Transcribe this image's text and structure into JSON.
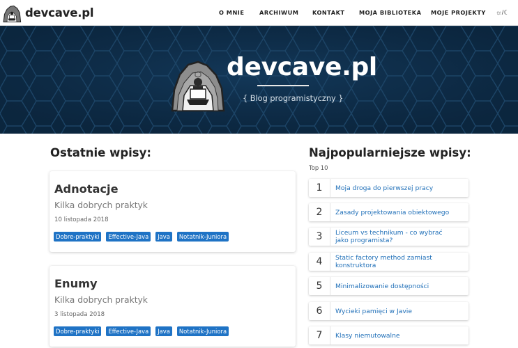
{
  "nav": {
    "brand": "devcave.pl",
    "items": [
      "O MNIE",
      "ARCHIWUM",
      "KONTAKT",
      "MOJA BIBLIOTEKA",
      "MOJE PROJEKTY"
    ],
    "theme_toggle": "☼/☾"
  },
  "hero": {
    "title": "devcave.pl",
    "subtitle": "{ Blog programistyczny }"
  },
  "latest": {
    "heading": "Ostatnie wpisy:",
    "posts": [
      {
        "title": "Adnotacje",
        "subtitle": "Kilka dobrych praktyk",
        "date": "10 listopada 2018",
        "tags": [
          "Dobre-praktyki",
          "Effective-Java",
          "Java",
          "Notatnik-Juniora"
        ]
      },
      {
        "title": "Enumy",
        "subtitle": "Kilka dobrych praktyk",
        "date": "3 listopada 2018",
        "tags": [
          "Dobre-praktyki",
          "Effective-Java",
          "Java",
          "Notatnik-Juniora"
        ]
      }
    ]
  },
  "popular": {
    "heading": "Najpopularniejsze wpisy:",
    "top_label": "Top 10",
    "items": [
      {
        "num": "1",
        "title": "Moja droga do pierwszej pracy"
      },
      {
        "num": "2",
        "title": "Zasady projektowania obiektowego"
      },
      {
        "num": "3",
        "title": "Liceum vs technikum - co wybrać jako programista?"
      },
      {
        "num": "4",
        "title": "Static factory method zamiast konstruktora"
      },
      {
        "num": "5",
        "title": "Minimalizowanie dostępności"
      },
      {
        "num": "6",
        "title": "Wycieki pamięci w Javie"
      },
      {
        "num": "7",
        "title": "Klasy niemutowalne"
      }
    ]
  },
  "colors": {
    "hero_bg": "#0d2b45",
    "tag_bg": "#1f73c5",
    "link": "#1f6fb8"
  }
}
